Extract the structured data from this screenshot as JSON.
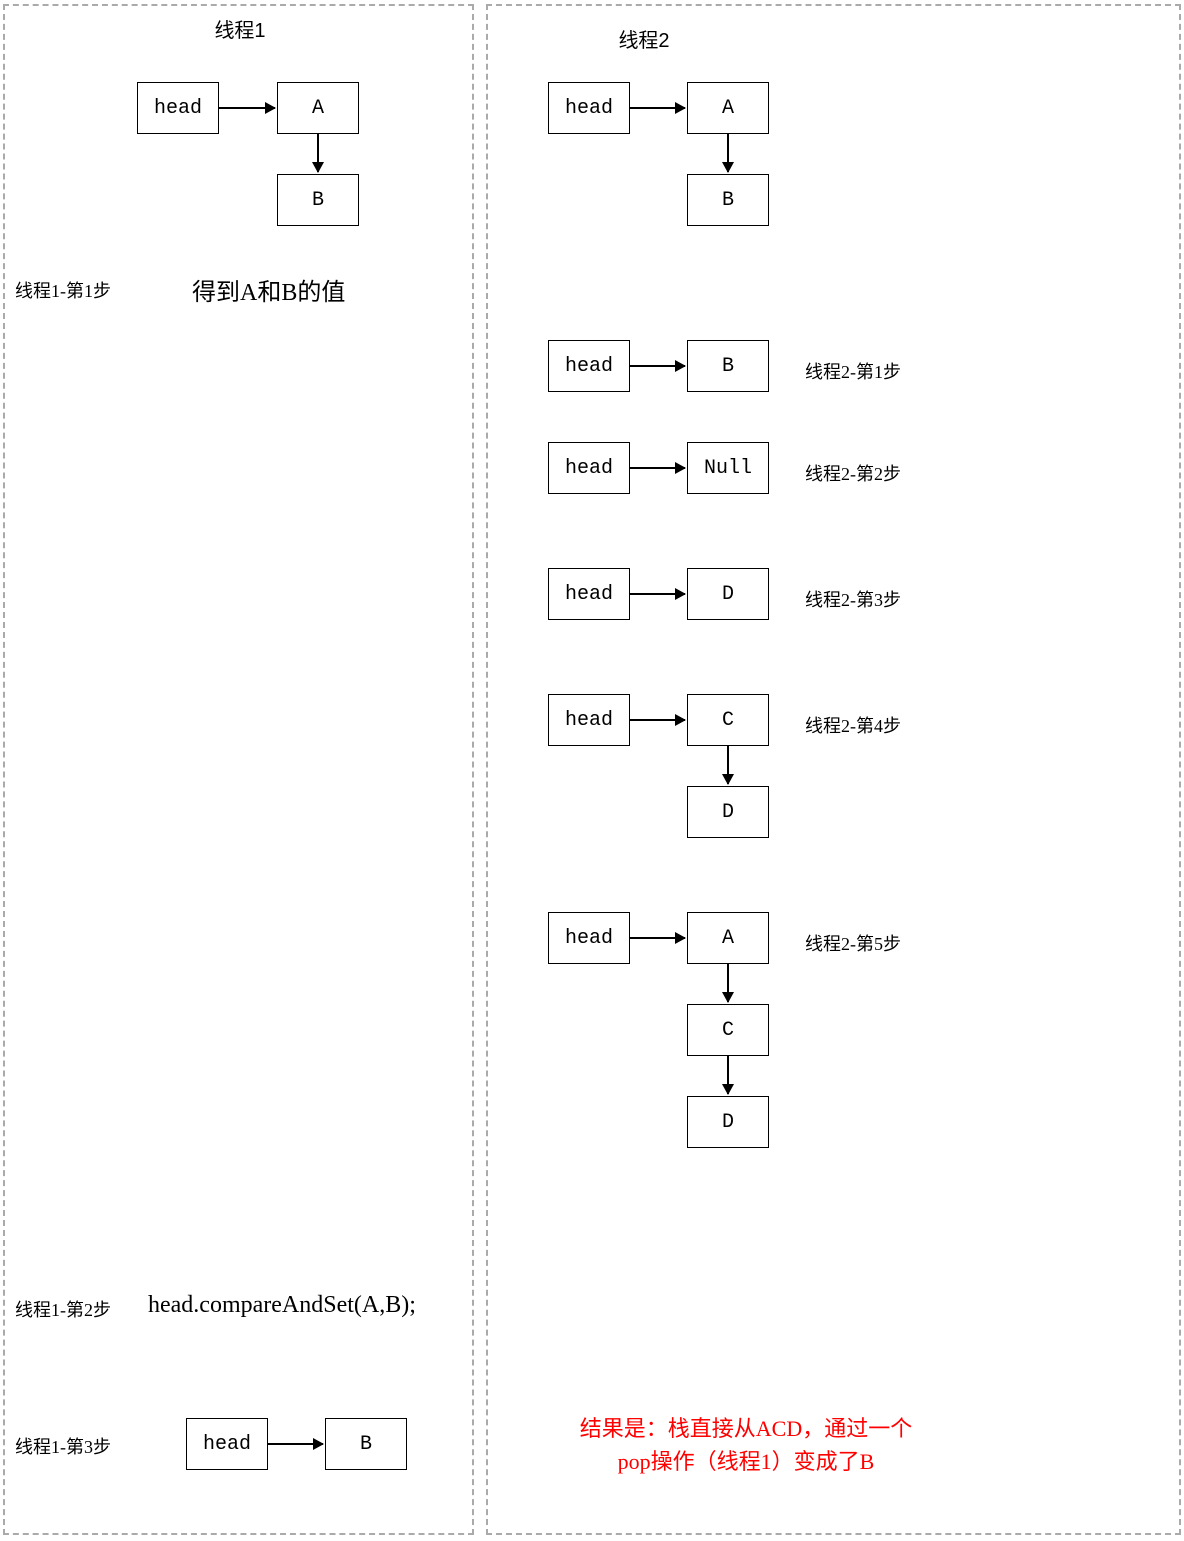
{
  "panels": {
    "left_title": "线程1",
    "right_title": "线程2"
  },
  "nodes": {
    "head": "head",
    "A": "A",
    "B": "B",
    "C": "C",
    "D": "D",
    "Null": "Null"
  },
  "left_steps": {
    "step1_label": "线程1-第1步",
    "step1_text": "得到A和B的值",
    "step2_label": "线程1-第2步",
    "step2_text": "head.compareAndSet(A,B);",
    "step3_label": "线程1-第3步"
  },
  "right_steps": {
    "step1_label": "线程2-第1步",
    "step2_label": "线程2-第2步",
    "step3_label": "线程2-第3步",
    "step4_label": "线程2-第4步",
    "step5_label": "线程2-第5步"
  },
  "result": "结果是：栈直接从ACD，通过一个\npop操作（线程1）变成了B"
}
